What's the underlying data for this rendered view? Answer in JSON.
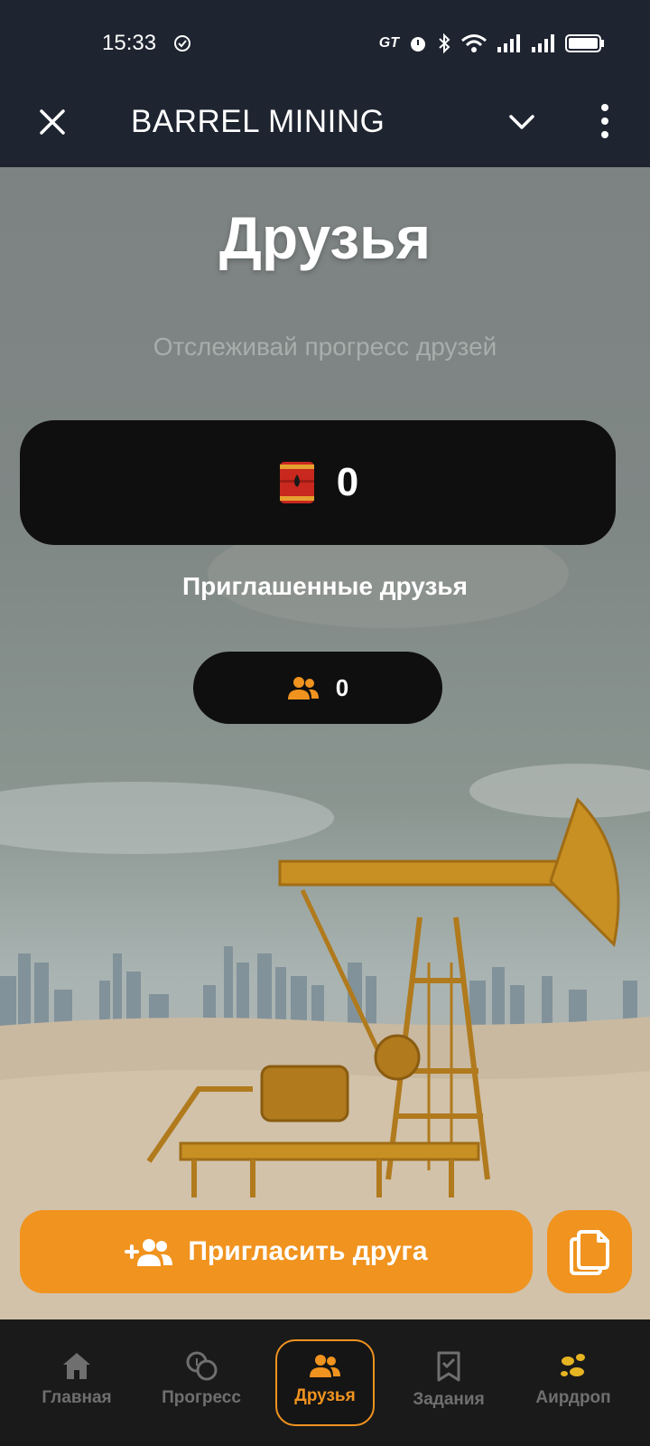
{
  "status_bar": {
    "time": "15:33",
    "carrier_badge": "GT"
  },
  "header": {
    "title": "BARREL MINING",
    "close_icon": "close-icon",
    "chevron_icon": "chevron-down-icon",
    "more_icon": "more-vertical-icon"
  },
  "page": {
    "title": "Друзья",
    "subtitle": "Отслеживай прогресс друзей",
    "balance": "0",
    "balance_icon": "oil-barrel-icon",
    "invited_label": "Приглашенные друзья",
    "invited_count": "0",
    "invited_icon": "users-icon"
  },
  "actions": {
    "invite_label": "Пригласить друга",
    "invite_icon": "user-plus-icon",
    "copy_icon": "copy-icon"
  },
  "nav": {
    "items": [
      {
        "label": "Главная",
        "icon": "home-icon"
      },
      {
        "label": "Прогресс",
        "icon": "coins-icon"
      },
      {
        "label": "Друзья",
        "icon": "users-icon",
        "active": true
      },
      {
        "label": "Задания",
        "icon": "bookmark-check-icon"
      },
      {
        "label": "Аирдроп",
        "icon": "airdrop-coins-icon"
      }
    ]
  },
  "colors": {
    "accent": "#f0931f",
    "bar_bg": "#1e2430",
    "card_bg": "#0f0f0f",
    "nav_bg": "#1a1a1a"
  }
}
